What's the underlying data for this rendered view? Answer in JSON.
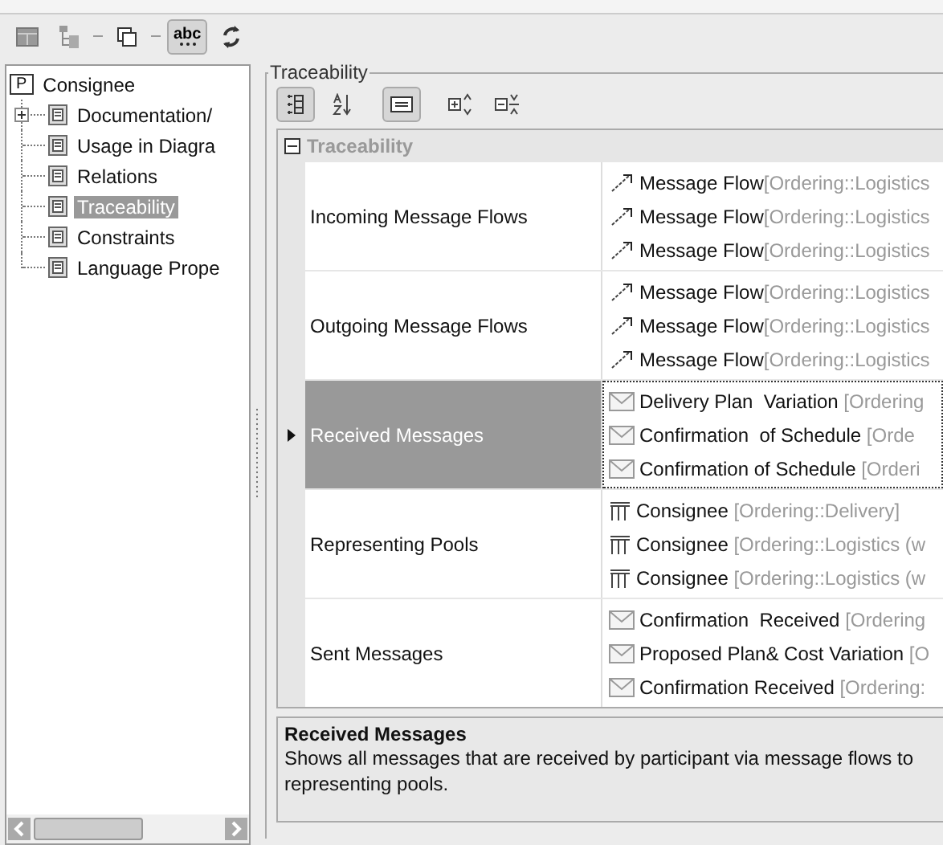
{
  "toolbar": [
    {
      "kind": "table",
      "pressed": false
    },
    {
      "kind": "tree",
      "pressed": false
    },
    {
      "kind": "copy",
      "pressed": false
    },
    {
      "kind": "text",
      "label": "abc",
      "pressed": true
    },
    {
      "kind": "refresh",
      "pressed": false
    }
  ],
  "tree": {
    "label": "Consignee",
    "badge": "P",
    "children": [
      {
        "label": "Documentation/",
        "expandable": true,
        "selected": false
      },
      {
        "label": "Usage in Diagra",
        "expandable": false,
        "selected": false
      },
      {
        "label": "Relations",
        "expandable": false,
        "selected": false
      },
      {
        "label": "Traceability",
        "expandable": false,
        "selected": true
      },
      {
        "label": "Constraints",
        "expandable": false,
        "selected": false
      },
      {
        "label": "Language Prope",
        "expandable": false,
        "selected": false
      }
    ]
  },
  "group_title": "Traceability",
  "panel_toolbar": [
    {
      "kind": "categorized",
      "pressed": true
    },
    {
      "kind": "sort",
      "pressed": false
    },
    {
      "kind": "description",
      "pressed": true
    },
    {
      "kind": "expand",
      "pressed": false
    },
    {
      "kind": "collapse",
      "pressed": false
    }
  ],
  "section": {
    "title": "Traceability",
    "expanded": true
  },
  "rows": [
    {
      "name": "Incoming Message Flows",
      "selected": false,
      "values": [
        {
          "kind": "flow",
          "name": "Message Flow",
          "owner": "[Ordering::Logistics"
        },
        {
          "kind": "flow",
          "name": "Message Flow",
          "owner": "[Ordering::Logistics"
        },
        {
          "kind": "flow",
          "name": "Message Flow",
          "owner": "[Ordering::Logistics"
        }
      ]
    },
    {
      "name": "Outgoing Message Flows",
      "selected": false,
      "values": [
        {
          "kind": "flow",
          "name": "Message Flow",
          "owner": "[Ordering::Logistics"
        },
        {
          "kind": "flow",
          "name": "Message Flow",
          "owner": "[Ordering::Logistics"
        },
        {
          "kind": "flow",
          "name": "Message Flow",
          "owner": "[Ordering::Logistics"
        }
      ]
    },
    {
      "name": "Received Messages",
      "selected": true,
      "values": [
        {
          "kind": "message",
          "name": "Delivery Plan  Variation",
          "owner": " [Ordering"
        },
        {
          "kind": "message",
          "name": "Confirmation  of Schedule",
          "owner": " [Orde"
        },
        {
          "kind": "message",
          "name": "Confirmation of Schedule",
          "owner": " [Orderi"
        }
      ]
    },
    {
      "name": "Representing Pools",
      "selected": false,
      "values": [
        {
          "kind": "pool",
          "name": "Consignee",
          "owner": " [Ordering::Delivery]"
        },
        {
          "kind": "pool",
          "name": "Consignee",
          "owner": " [Ordering::Logistics (w"
        },
        {
          "kind": "pool",
          "name": "Consignee",
          "owner": " [Ordering::Logistics (w"
        }
      ]
    },
    {
      "name": "Sent Messages",
      "selected": false,
      "values": [
        {
          "kind": "message",
          "name": "Confirmation  Received",
          "owner": " [Ordering"
        },
        {
          "kind": "message",
          "name": "Proposed Plan& Cost Variation",
          "owner": " [O"
        },
        {
          "kind": "message",
          "name": "Confirmation Received",
          "owner": " [Ordering:"
        }
      ]
    }
  ],
  "description": {
    "title": "Received Messages",
    "text": "Shows all messages that are received by participant via message flows to representing pools."
  }
}
